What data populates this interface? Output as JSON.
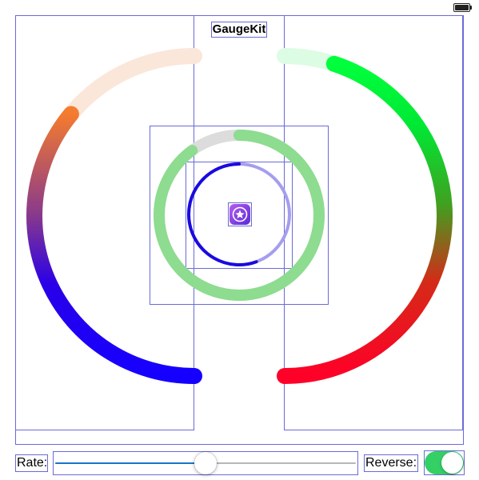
{
  "app": {
    "title": "GaugeKit"
  },
  "status_bar": {
    "battery_icon": "battery-full-icon"
  },
  "gauges": {
    "left_arc": {
      "track_color": "#fbe6da",
      "gradient": [
        "#1500ff",
        "#6b0fb0",
        "#f47b2f"
      ],
      "progress_fraction": 0.72
    },
    "right_arc": {
      "track_color": "#dcfce4",
      "gradient": [
        "#ff0028",
        "#46a11c",
        "#00ff3c"
      ],
      "progress_fraction": 0.9
    },
    "outer_ring": {
      "track_color": "#dcdcdc",
      "fill_color": "#8ddc8f",
      "progress_fraction": 0.9
    },
    "inner_ring": {
      "track_color": "#a59dee",
      "fill_color": "#1a0adf",
      "progress_fraction": 0.5
    },
    "center_icon": "star-badge-icon"
  },
  "controls": {
    "rate_label": "Rate:",
    "rate_value": 0.5,
    "reverse_label": "Reverse:",
    "reverse_on": true,
    "switch_on_color": "#34d065"
  }
}
